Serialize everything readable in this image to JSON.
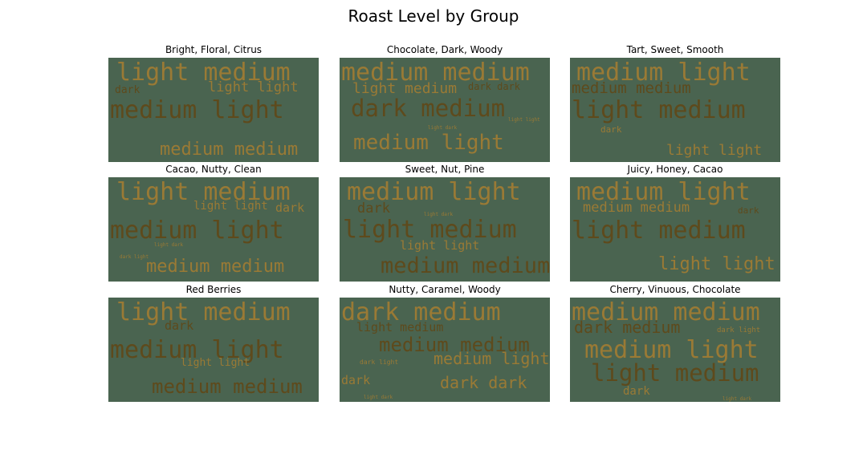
{
  "title": "Roast Level by Group",
  "colors": {
    "background": "#4a6450",
    "word_light": "#9a7a35",
    "word_dark": "#5e4a1c",
    "word_mid": "#7f6428"
  },
  "chart_data": {
    "type": "wordcloud",
    "title": "Roast Level by Group",
    "panels": [
      {
        "title": "Bright, Floral, Citrus",
        "words": [
          {
            "text": "light medium",
            "weight": 1.0,
            "tone": "light"
          },
          {
            "text": "medium light",
            "weight": 1.0,
            "tone": "dark"
          },
          {
            "text": "medium medium",
            "weight": 0.72,
            "tone": "light"
          },
          {
            "text": "light light",
            "weight": 0.55,
            "tone": "light"
          },
          {
            "text": "dark",
            "weight": 0.42,
            "tone": "dark"
          }
        ]
      },
      {
        "title": "Chocolate, Dark, Woody",
        "words": [
          {
            "text": "medium medium",
            "weight": 1.0,
            "tone": "light"
          },
          {
            "text": "dark medium",
            "weight": 0.95,
            "tone": "dark"
          },
          {
            "text": "medium light",
            "weight": 0.88,
            "tone": "light"
          },
          {
            "text": "light medium",
            "weight": 0.6,
            "tone": "light"
          },
          {
            "text": "dark dark",
            "weight": 0.4,
            "tone": "dark"
          },
          {
            "text": "light dark",
            "weight": 0.2,
            "tone": "light"
          },
          {
            "text": "light light",
            "weight": 0.2,
            "tone": "light"
          }
        ]
      },
      {
        "title": "Tart, Sweet, Smooth",
        "words": [
          {
            "text": "medium light",
            "weight": 1.0,
            "tone": "light"
          },
          {
            "text": "light medium",
            "weight": 1.0,
            "tone": "dark"
          },
          {
            "text": "medium medium",
            "weight": 0.62,
            "tone": "dark"
          },
          {
            "text": "light light",
            "weight": 0.6,
            "tone": "light"
          },
          {
            "text": "dark",
            "weight": 0.35,
            "tone": "light"
          }
        ]
      },
      {
        "title": "Cacao, Nutty, Clean",
        "words": [
          {
            "text": "light medium",
            "weight": 1.0,
            "tone": "light"
          },
          {
            "text": "medium light",
            "weight": 1.0,
            "tone": "dark"
          },
          {
            "text": "medium medium",
            "weight": 0.72,
            "tone": "light"
          },
          {
            "text": "light light",
            "weight": 0.45,
            "tone": "light"
          },
          {
            "text": "dark",
            "weight": 0.5,
            "tone": "light"
          },
          {
            "text": "light dark",
            "weight": 0.15,
            "tone": "light"
          },
          {
            "text": "dark light",
            "weight": 0.2,
            "tone": "light"
          }
        ]
      },
      {
        "title": "Sweet, Nut, Pine",
        "words": [
          {
            "text": "medium light",
            "weight": 1.0,
            "tone": "light"
          },
          {
            "text": "light medium",
            "weight": 1.0,
            "tone": "dark"
          },
          {
            "text": "medium medium",
            "weight": 0.9,
            "tone": "dark"
          },
          {
            "text": "light light",
            "weight": 0.5,
            "tone": "light"
          },
          {
            "text": "dark",
            "weight": 0.55,
            "tone": "dark"
          },
          {
            "text": "light dark",
            "weight": 0.2,
            "tone": "light"
          }
        ]
      },
      {
        "title": "Juicy, Honey, Cacao",
        "words": [
          {
            "text": "medium light",
            "weight": 1.0,
            "tone": "light"
          },
          {
            "text": "light medium",
            "weight": 1.0,
            "tone": "dark"
          },
          {
            "text": "light light",
            "weight": 0.72,
            "tone": "light"
          },
          {
            "text": "medium medium",
            "weight": 0.55,
            "tone": "light"
          },
          {
            "text": "dark",
            "weight": 0.35,
            "tone": "dark"
          }
        ]
      },
      {
        "title": "Red Berries",
        "words": [
          {
            "text": "light medium",
            "weight": 1.0,
            "tone": "light"
          },
          {
            "text": "medium light",
            "weight": 1.0,
            "tone": "dark"
          },
          {
            "text": "medium medium",
            "weight": 0.8,
            "tone": "dark"
          },
          {
            "text": "light light",
            "weight": 0.42,
            "tone": "light"
          },
          {
            "text": "dark",
            "weight": 0.5,
            "tone": "dark"
          }
        ]
      },
      {
        "title": "Nutty, Caramel, Woody",
        "words": [
          {
            "text": "dark medium",
            "weight": 1.0,
            "tone": "light"
          },
          {
            "text": "medium medium",
            "weight": 0.8,
            "tone": "dark"
          },
          {
            "text": "medium light",
            "weight": 0.68,
            "tone": "light"
          },
          {
            "text": "dark dark",
            "weight": 0.68,
            "tone": "light"
          },
          {
            "text": "light medium",
            "weight": 0.5,
            "tone": "dark"
          },
          {
            "text": "dark",
            "weight": 0.5,
            "tone": "light"
          },
          {
            "text": "dark light",
            "weight": 0.28,
            "tone": "light"
          },
          {
            "text": "light dark",
            "weight": 0.2,
            "tone": "light"
          }
        ]
      },
      {
        "title": "Cherry, Vinuous, Chocolate",
        "words": [
          {
            "text": "medium medium",
            "weight": 1.0,
            "tone": "light"
          },
          {
            "text": "medium light",
            "weight": 1.0,
            "tone": "light"
          },
          {
            "text": "light medium",
            "weight": 0.95,
            "tone": "dark"
          },
          {
            "text": "dark medium",
            "weight": 0.68,
            "tone": "dark"
          },
          {
            "text": "dark",
            "weight": 0.45,
            "tone": "light"
          },
          {
            "text": "dark light",
            "weight": 0.3,
            "tone": "light"
          },
          {
            "text": "light dark",
            "weight": 0.2,
            "tone": "light"
          }
        ]
      }
    ]
  }
}
